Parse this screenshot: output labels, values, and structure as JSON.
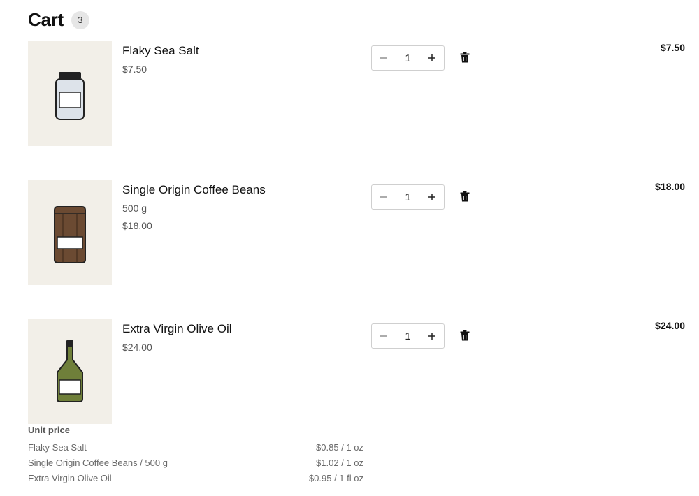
{
  "cart": {
    "title": "Cart",
    "count": "3"
  },
  "items": [
    {
      "name": "Flaky Sea Salt",
      "variant": "",
      "price": "$7.50",
      "quantity": "1",
      "line_total": "$7.50",
      "image_icon": "salt-jar-icon"
    },
    {
      "name": "Single Origin Coffee Beans",
      "variant": "500 g",
      "price": "$18.00",
      "quantity": "1",
      "line_total": "$18.00",
      "image_icon": "coffee-bag-icon"
    },
    {
      "name": "Extra Virgin Olive Oil",
      "variant": "",
      "price": "$24.00",
      "quantity": "1",
      "line_total": "$24.00",
      "image_icon": "olive-oil-bottle-icon"
    }
  ],
  "unit_price": {
    "title": "Unit price",
    "rows": [
      {
        "label": "Flaky Sea Salt",
        "value": "$0.85 / 1 oz"
      },
      {
        "label": "Single Origin Coffee Beans / 500 g",
        "value": "$1.02 / 1 oz"
      },
      {
        "label": "Extra Virgin Olive Oil",
        "value": "$0.95 / 1 fl oz"
      }
    ]
  },
  "colors": {
    "thumb_bg": "#f2efe8",
    "salt_jar": "#dde3ea",
    "coffee_bag": "#6b4a32",
    "olive_bottle": "#6f7f3a"
  }
}
